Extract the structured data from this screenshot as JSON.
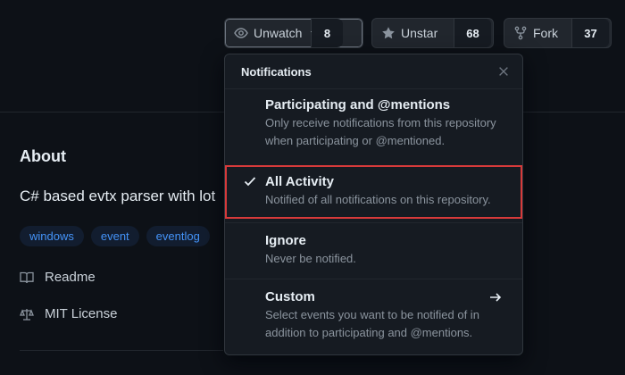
{
  "actions": {
    "watch": {
      "label": "Unwatch",
      "count": "8",
      "icon": "eye-icon"
    },
    "star": {
      "label": "Unstar",
      "count": "68",
      "icon": "star-icon"
    },
    "fork": {
      "label": "Fork",
      "count": "37",
      "icon": "fork-icon"
    }
  },
  "about": {
    "title": "About",
    "description": "C# based evtx parser with lot",
    "topics": [
      "windows",
      "event",
      "eventlog"
    ],
    "readme": "Readme",
    "license": "MIT License"
  },
  "notifications": {
    "title": "Notifications",
    "options": [
      {
        "title": "Participating and @mentions",
        "desc1": "Only receive notifications from this repository",
        "desc2": "when participating or @mentioned."
      },
      {
        "title": "All Activity",
        "desc1": "Notified of all notifications on this repository.",
        "selected": true
      },
      {
        "title": "Ignore",
        "desc1": "Never be notified."
      },
      {
        "title": "Custom",
        "desc1": "Select events you want to be notified of in",
        "desc2": "addition to participating and @mentions."
      }
    ]
  },
  "colors": {
    "background": "#0d1117",
    "accent": "#4493f8",
    "highlight": "#d73a3a"
  }
}
